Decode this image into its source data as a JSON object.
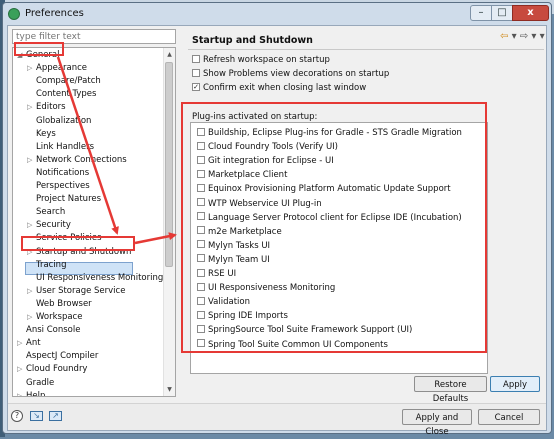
{
  "window": {
    "title": "Preferences",
    "minimize_glyph": "–",
    "maximize_glyph": "□",
    "close_glyph": "x"
  },
  "left": {
    "filter_placeholder": "type filter text",
    "tree": [
      {
        "label": "General",
        "arrow": "◢",
        "indent": 0
      },
      {
        "label": "Appearance",
        "arrow": "▷",
        "indent": 1
      },
      {
        "label": "Compare/Patch",
        "arrow": "",
        "indent": 1
      },
      {
        "label": "Content Types",
        "arrow": "",
        "indent": 1
      },
      {
        "label": "Editors",
        "arrow": "▷",
        "indent": 1
      },
      {
        "label": "Globalization",
        "arrow": "",
        "indent": 1
      },
      {
        "label": "Keys",
        "arrow": "",
        "indent": 1
      },
      {
        "label": "Link Handlers",
        "arrow": "",
        "indent": 1
      },
      {
        "label": "Network Connections",
        "arrow": "▷",
        "indent": 1
      },
      {
        "label": "Notifications",
        "arrow": "",
        "indent": 1
      },
      {
        "label": "Perspectives",
        "arrow": "",
        "indent": 1
      },
      {
        "label": "Project Natures",
        "arrow": "",
        "indent": 1
      },
      {
        "label": "Search",
        "arrow": "",
        "indent": 1
      },
      {
        "label": "Security",
        "arrow": "▷",
        "indent": 1
      },
      {
        "label": "Service Policies",
        "arrow": "",
        "indent": 1
      },
      {
        "label": "Startup and Shutdown",
        "arrow": "▷",
        "indent": 1
      },
      {
        "label": "Tracing",
        "arrow": "",
        "indent": 1
      },
      {
        "label": "UI Responsiveness Monitoring",
        "arrow": "",
        "indent": 1
      },
      {
        "label": "User Storage Service",
        "arrow": "▷",
        "indent": 1
      },
      {
        "label": "Web Browser",
        "arrow": "",
        "indent": 1
      },
      {
        "label": "Workspace",
        "arrow": "▷",
        "indent": 1
      },
      {
        "label": "Ansi Console",
        "arrow": "",
        "indent": 0
      },
      {
        "label": "Ant",
        "arrow": "▷",
        "indent": 0
      },
      {
        "label": "AspectJ Compiler",
        "arrow": "",
        "indent": 0
      },
      {
        "label": "Cloud Foundry",
        "arrow": "▷",
        "indent": 0
      },
      {
        "label": "Gradle",
        "arrow": "",
        "indent": 0
      },
      {
        "label": "Help",
        "arrow": "▷",
        "indent": 0
      }
    ],
    "selected": "Startup and Shutdown"
  },
  "right": {
    "title": "Startup and Shutdown",
    "options": [
      {
        "label": "Refresh workspace on startup",
        "checked": false
      },
      {
        "label": "Show Problems view decorations on startup",
        "checked": false
      },
      {
        "label": "Confirm exit when closing last window",
        "checked": true
      }
    ],
    "plugins_label": "Plug-ins activated on startup:",
    "plugins": [
      {
        "label": "Buildship, Eclipse Plug-ins for Gradle - STS Gradle Migration",
        "checked": false
      },
      {
        "label": "Cloud Foundry Tools (Verify UI)",
        "checked": false
      },
      {
        "label": "Git integration for Eclipse - UI",
        "checked": false
      },
      {
        "label": "Marketplace Client",
        "checked": false
      },
      {
        "label": "Equinox Provisioning Platform Automatic Update Support",
        "checked": false
      },
      {
        "label": "WTP Webservice UI Plug-in",
        "checked": false
      },
      {
        "label": "Language Server Protocol client for Eclipse IDE (Incubation)",
        "checked": false
      },
      {
        "label": "m2e Marketplace",
        "checked": false
      },
      {
        "label": "Mylyn Tasks UI",
        "checked": false
      },
      {
        "label": "Mylyn Team UI",
        "checked": false
      },
      {
        "label": "RSE UI",
        "checked": false
      },
      {
        "label": "UI Responsiveness Monitoring",
        "checked": false
      },
      {
        "label": "Validation",
        "checked": false
      },
      {
        "label": "Spring IDE Imports",
        "checked": false
      },
      {
        "label": "SpringSource Tool Suite Framework Support (UI)",
        "checked": false
      },
      {
        "label": "Spring Tool Suite Common UI Components",
        "checked": false
      }
    ],
    "restore_defaults": "Restore Defaults",
    "apply": "Apply"
  },
  "footer": {
    "apply_close": "Apply and Close",
    "cancel": "Cancel",
    "help_glyph": "?"
  },
  "colors": {
    "annotation_red": "#e53935",
    "close_button": "#c74a3e",
    "selection_bg": "#cfe3f7"
  }
}
